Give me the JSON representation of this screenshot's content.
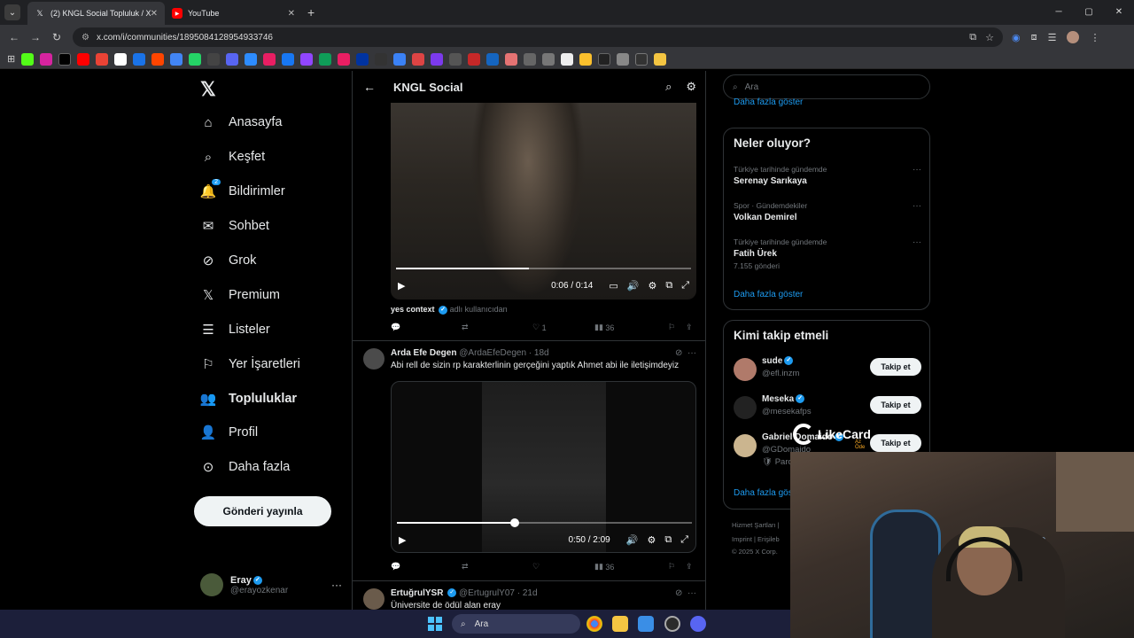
{
  "browser": {
    "tabs": [
      {
        "title": "(2) KNGL Social Topluluk / X",
        "icon": "x-logo-icon"
      },
      {
        "title": "YouTube",
        "icon": "youtube-icon"
      }
    ],
    "url": "x.com/i/communities/1895084128954933746"
  },
  "nav": {
    "items": [
      {
        "label": "Anasayfa",
        "icon": "home-icon"
      },
      {
        "label": "Keşfet",
        "icon": "search-icon"
      },
      {
        "label": "Bildirimler",
        "icon": "bell-icon",
        "badge": "2"
      },
      {
        "label": "Sohbet",
        "icon": "mail-icon"
      },
      {
        "label": "Grok",
        "icon": "grok-icon"
      },
      {
        "label": "Premium",
        "icon": "x-premium-icon"
      },
      {
        "label": "Listeler",
        "icon": "list-icon"
      },
      {
        "label": "Yer İşaretleri",
        "icon": "bookmark-icon"
      },
      {
        "label": "Topluluklar",
        "icon": "communities-icon"
      },
      {
        "label": "Profil",
        "icon": "person-icon"
      },
      {
        "label": "Daha fazla",
        "icon": "more-circle-icon"
      }
    ],
    "post_button": "Gönderi yayınla",
    "profile": {
      "name": "Eray",
      "handle": "@erayozkenar"
    }
  },
  "main": {
    "title": "KNGL Social",
    "video1": {
      "time": "0:06 / 0:14",
      "progress": 0.45
    },
    "context": {
      "label": "yes context",
      "note": "adlı kullanıcıdan"
    },
    "actions1": {
      "likes": "1",
      "views": "36"
    },
    "tweet2": {
      "name": "Arda Efe Degen",
      "handle": "@ArdaEfeDegen · 18d",
      "text": "Abi rell de sizin rp karakterlinin gerçeğini yaptık Ahmet abi ile iletişimdeyiz",
      "video_time": "0:50 / 2:09",
      "progress": 0.4,
      "views": "36"
    },
    "tweet3": {
      "name": "ErtuğrulYSR",
      "handle": "@ErtugrulY07 · 21d",
      "text": "Üniversite de ödül alan eray"
    }
  },
  "right": {
    "search_placeholder": "Ara",
    "top_more": "Daha fazla göster",
    "trends_title": "Neler oluyor?",
    "trends": [
      {
        "meta": "Türkiye tarihinde gündemde",
        "name": "Serenay Sarıkaya",
        "count": ""
      },
      {
        "meta": "Spor · Gündemdekiler",
        "name": "Volkan Demirel",
        "count": ""
      },
      {
        "meta": "Türkiye tarihinde gündemde",
        "name": "Fatih Ürek",
        "count": "7.155 gönderi"
      }
    ],
    "trends_more": "Daha fazla göster",
    "who_title": "Kimi takip etmeli",
    "who": [
      {
        "name": "sude",
        "handle": "@efl.inzm",
        "button": "Takip et"
      },
      {
        "name": "Meseka",
        "handle": "@mesekafps",
        "button": "Takip et"
      },
      {
        "name": "Gabriel Domaido",
        "handle": "@GDomaido",
        "button": "Takip et",
        "extra": "Paro"
      }
    ],
    "who_more": "Daha fazla göster",
    "footer": [
      "Hizmet Şartları |",
      "Imprint | Erişileb",
      "© 2025 X Corp."
    ]
  },
  "overlay": {
    "brand": "LikeCard",
    "sub": "Az Öde"
  },
  "taskbar": {
    "search": "Ara"
  }
}
